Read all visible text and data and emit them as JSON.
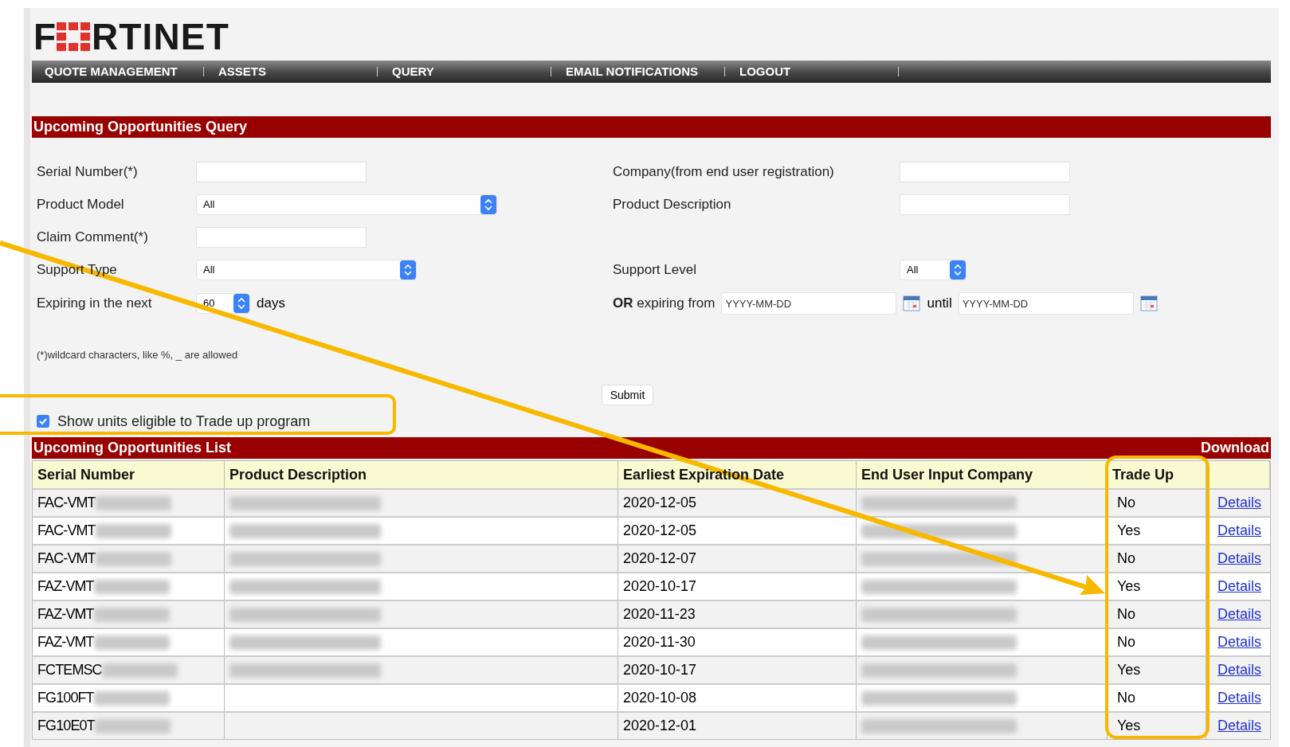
{
  "logo": {
    "before": "F",
    "after": "RTINET"
  },
  "nav": [
    "QUOTE MANAGEMENT",
    "ASSETS",
    "QUERY",
    "EMAIL NOTIFICATIONS",
    "LOGOUT"
  ],
  "query": {
    "title": "Upcoming Opportunities Query",
    "serial": {
      "label": "Serial Number(*)"
    },
    "company": {
      "label": "Company(from end user registration)"
    },
    "model": {
      "label": "Product Model",
      "value": "All"
    },
    "description": {
      "label": "Product Description"
    },
    "claim": {
      "label": "Claim Comment(*)"
    },
    "support_type": {
      "label": "Support Type",
      "value": "All"
    },
    "support_level": {
      "label": "Support Level",
      "value": "All"
    },
    "expiring": {
      "label": "Expiring in the next",
      "value": "60",
      "unit": "days"
    },
    "range": {
      "label": "**OR** expiring from",
      "from_placeholder": "YYYY-MM-DD",
      "until": "until",
      "until_placeholder": "YYYY-MM-DD"
    },
    "note": "(*)wildcard characters, like %, _ are allowed",
    "submit": "Submit"
  },
  "trade_up_filter": {
    "label": "Show units eligible to Trade up program",
    "checked": true
  },
  "list": {
    "title": "Upcoming Opportunities List",
    "download": "Download",
    "columns": [
      "Serial Number",
      "Product Description",
      "Earliest Expiration Date",
      "End User Input Company",
      "Trade Up"
    ],
    "rows": [
      {
        "serial": "FAC-VMT",
        "description_blurred": true,
        "date": "2020-12-05",
        "trade_up": "No",
        "link": "Details"
      },
      {
        "serial": "FAC-VMT",
        "description_blurred": true,
        "date": "2020-12-05",
        "trade_up": "Yes",
        "link": "Details"
      },
      {
        "serial": "FAC-VMT",
        "description_blurred": true,
        "date": "2020-12-07",
        "trade_up": "No",
        "link": "Details"
      },
      {
        "serial": "FAZ-VMT",
        "description_blurred": true,
        "date": "2020-10-17",
        "trade_up": "Yes",
        "link": "Details"
      },
      {
        "serial": "FAZ-VMT",
        "description_blurred": true,
        "date": "2020-11-23",
        "trade_up": "No",
        "link": "Details"
      },
      {
        "serial": "FAZ-VMT",
        "description_blurred": true,
        "date": "2020-11-30",
        "trade_up": "No",
        "link": "Details"
      },
      {
        "serial": "FCTEMSC",
        "description_blurred": true,
        "date": "2020-10-17",
        "trade_up": "Yes",
        "link": "Details"
      },
      {
        "serial": "FG100FT",
        "description_blurred": false,
        "date": "2020-10-08",
        "trade_up": "No",
        "link": "Details"
      },
      {
        "serial": "FG10E0T",
        "description_blurred": false,
        "date": "2020-12-01",
        "trade_up": "Yes",
        "link": "Details"
      }
    ]
  }
}
